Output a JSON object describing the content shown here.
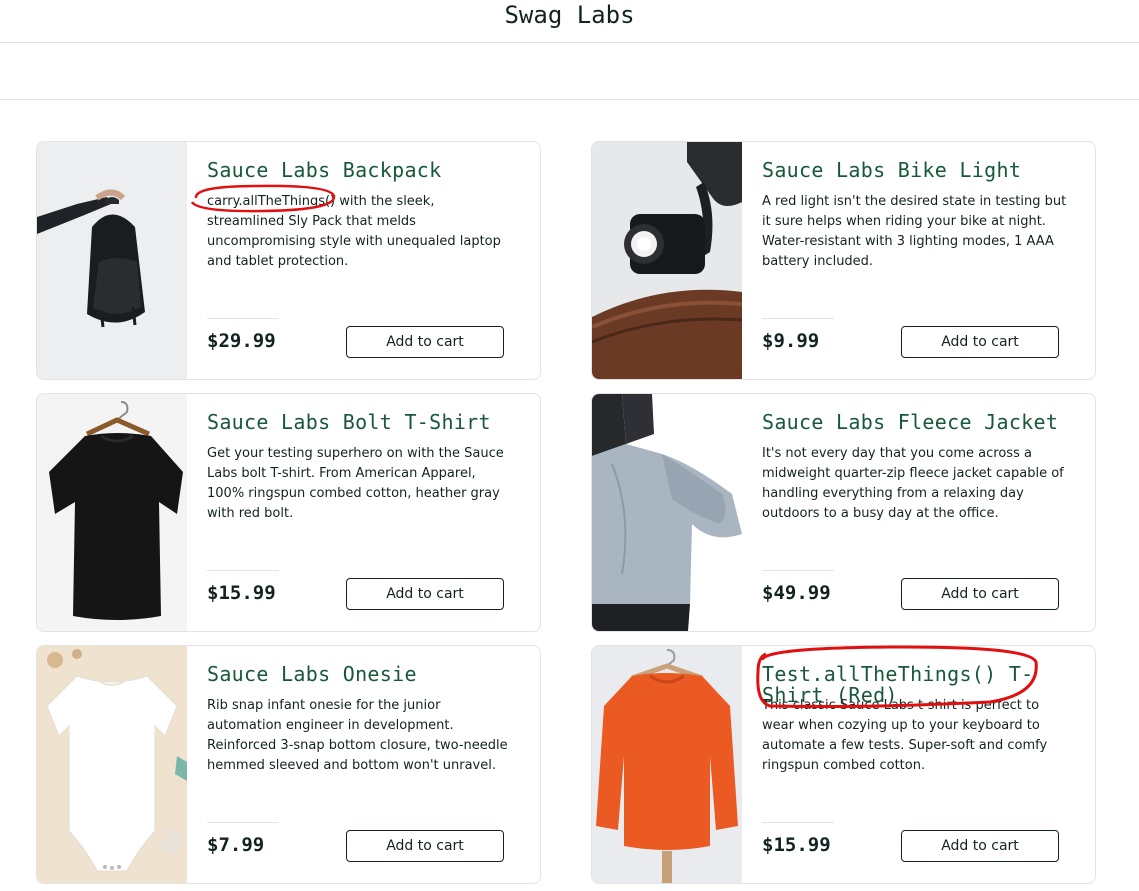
{
  "app": {
    "title": "Swag Labs"
  },
  "products": [
    {
      "name": "Sauce Labs Backpack",
      "description": "carry.allTheThings() with the sleek, streamlined Sly Pack that melds uncompromising style with unequaled laptop and tablet protection.",
      "price": "$29.99",
      "button": "Add to cart"
    },
    {
      "name": "Sauce Labs Bike Light",
      "description": "A red light isn't the desired state in testing but it sure helps when riding your bike at night. Water-resistant with 3 lighting modes, 1 AAA battery included.",
      "price": "$9.99",
      "button": "Add to cart"
    },
    {
      "name": "Sauce Labs Bolt T-Shirt",
      "description": "Get your testing superhero on with the Sauce Labs bolt T-shirt. From American Apparel, 100% ringspun combed cotton, heather gray with red bolt.",
      "price": "$15.99",
      "button": "Add to cart"
    },
    {
      "name": "Sauce Labs Fleece Jacket",
      "description": "It's not every day that you come across a midweight quarter-zip fleece jacket capable of handling everything from a relaxing day outdoors to a busy day at the office.",
      "price": "$49.99",
      "button": "Add to cart"
    },
    {
      "name": "Sauce Labs Onesie",
      "description": "Rib snap infant onesie for the junior automation engineer in development. Reinforced 3-snap bottom closure, two-needle hemmed sleeved and bottom won't unravel.",
      "price": "$7.99",
      "button": "Add to cart"
    },
    {
      "name": "Test.allTheThings() T-Shirt (Red)",
      "description": "This classic Sauce Labs t-shirt is perfect to wear when cozying up to your keyboard to automate a few tests. Super-soft and comfy ringspun combed cotton.",
      "price": "$15.99",
      "button": "Add to cart"
    }
  ],
  "colors": {
    "product_name": "#18583a",
    "text": "#132322",
    "annotation": "#e01010",
    "border": "#e3e3e3"
  }
}
